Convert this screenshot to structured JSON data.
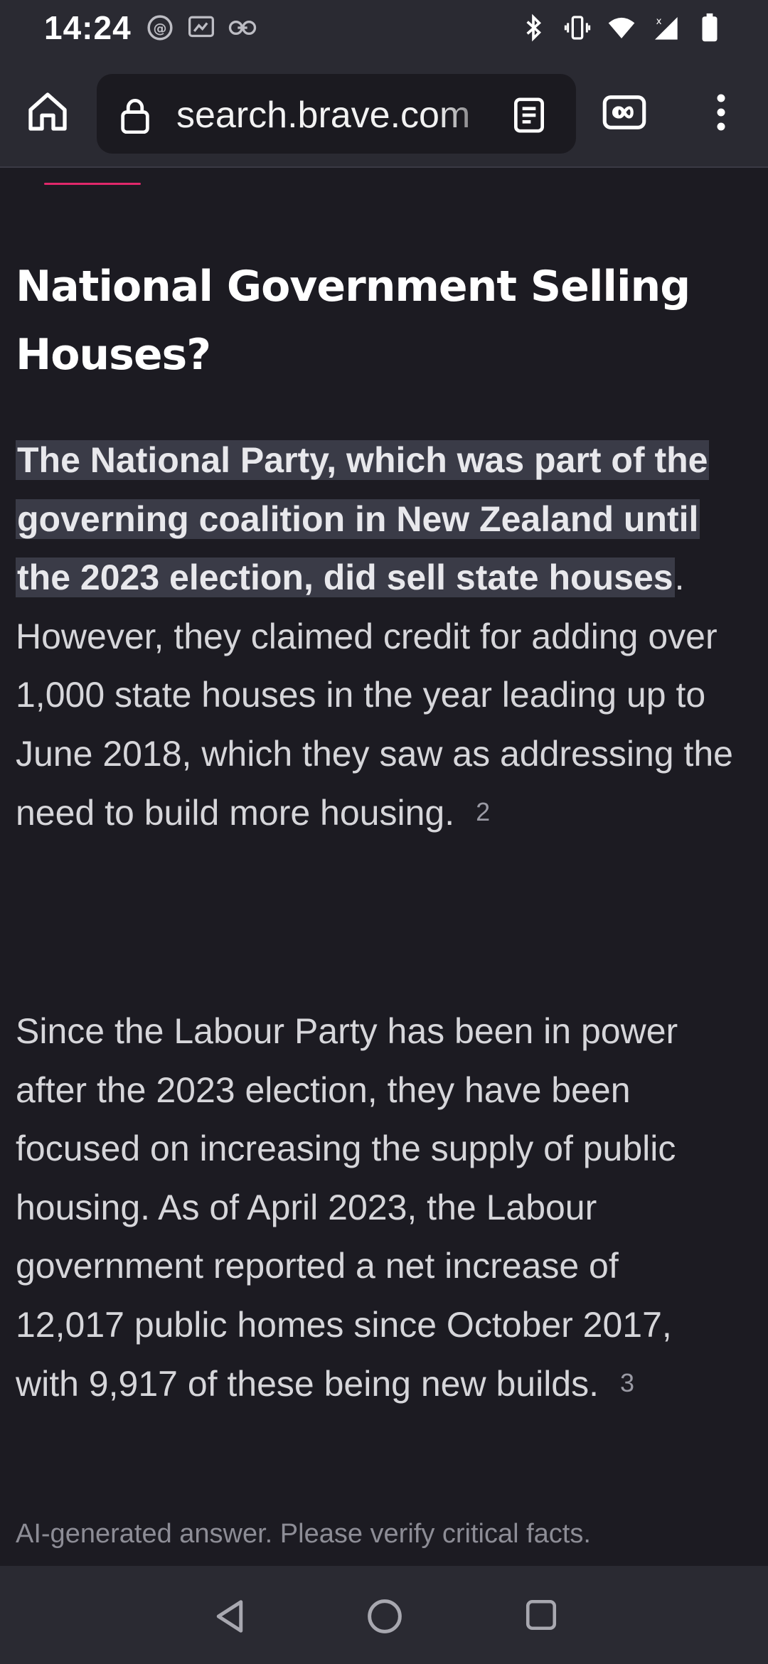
{
  "status_bar": {
    "time": "14:24",
    "left_icons": [
      "threads-icon",
      "screen-cast-icon",
      "link-icon"
    ],
    "right_icons": [
      "bluetooth-icon",
      "vibrate-icon",
      "wifi-icon",
      "signal-icon",
      "battery-icon"
    ]
  },
  "toolbar": {
    "url": "search.brave.com"
  },
  "article": {
    "heading": "National Government Selling Houses?",
    "para1_highlight": "The National Party, which was part of the governing coalition in New Zealand until the 2023 election, did sell state houses",
    "para1_rest": ". However, they claimed credit for adding over 1,000 state houses in the year leading up to June 2018, which they saw as addressing the need to build more housing.",
    "para1_cite": "2",
    "para2_text": "Since the Labour Party has been in power after the 2023 election, they have been focused on increasing the supply of public housing. As of April 2023, the Labour government reported a net increase of 12,017 public homes since October 2017, with 9,917 of these being new builds.",
    "para2_cite": "3",
    "disclaimer": "AI-generated answer. Please verify critical facts."
  },
  "colors": {
    "background": "#1c1b22",
    "bar": "#2a2a32",
    "accent": "#e0286b",
    "highlight": "#3a3b47"
  }
}
